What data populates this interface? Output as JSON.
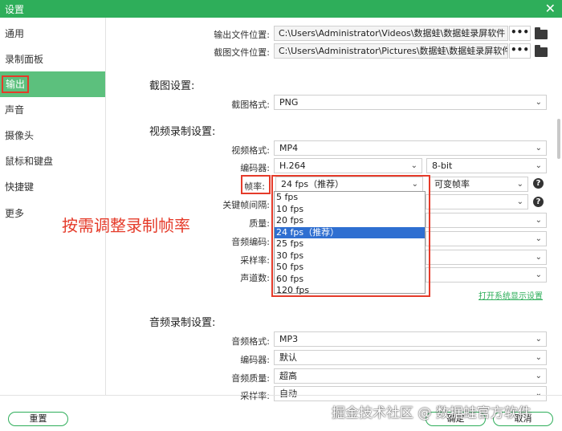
{
  "window": {
    "title": "设置",
    "close_glyph": "✕"
  },
  "sidebar": {
    "items": [
      {
        "label": "通用"
      },
      {
        "label": "录制面板"
      },
      {
        "label": "输出"
      },
      {
        "label": "声音"
      },
      {
        "label": "摄像头"
      },
      {
        "label": "鼠标和键盘"
      },
      {
        "label": "快捷键"
      },
      {
        "label": "更多"
      }
    ],
    "active": "输出"
  },
  "output": {
    "file_location_label": "输出文件位置:",
    "file_location_value": "C:\\Users\\Administrator\\Videos\\数据蛙\\数据蛙录屏软件",
    "screenshot_location_label": "截图文件位置:",
    "screenshot_location_value": "C:\\Users\\Administrator\\Pictures\\数据蛙\\数据蛙录屏软件",
    "browse_label": "•••"
  },
  "screenshot_settings": {
    "title": "截图设置:",
    "format_label": "截图格式:",
    "format_value": "PNG"
  },
  "video_settings": {
    "title": "视频录制设置:",
    "format_label": "视频格式:",
    "format_value": "MP4",
    "encoder_label": "编码器:",
    "encoder_value": "H.264",
    "bitdepth_value": "8-bit",
    "framerate_label": "帧率:",
    "framerate_value": "24 fps（推荐）",
    "framerate_mode_value": "可变帧率",
    "keyframe_label": "关键帧间隔:",
    "quality_label": "质量:",
    "audio_encoder_label": "音频编码:",
    "sample_rate_label": "采样率:",
    "channels_label": "声道数:",
    "framerate_options": [
      "5 fps",
      "10 fps",
      "20 fps",
      "24 fps（推荐）",
      "25 fps",
      "30 fps",
      "50 fps",
      "60 fps",
      "120 fps"
    ],
    "selected_option": "24 fps（推荐）",
    "system_display_link": "打开系统显示设置"
  },
  "audio_settings": {
    "title": "音频录制设置:",
    "format_label": "音频格式:",
    "format_value": "MP3",
    "encoder_label": "编码器:",
    "encoder_value": "默认",
    "quality_label": "音频质量:",
    "quality_value": "超高",
    "sample_rate_label": "采样率:",
    "sample_rate_value": "自动"
  },
  "annotation": "按需调整录制帧率",
  "footer": {
    "reset_label": "重置",
    "ok_label": "确定",
    "cancel_label": "取消",
    "watermark": "掘金技术社区 @ 数据蛙官方软件"
  },
  "colors": {
    "brand_green": "#2eae5a",
    "active_green": "#5cc07d",
    "highlight_red": "#e53b2a",
    "selection_blue": "#2f6fd1"
  }
}
